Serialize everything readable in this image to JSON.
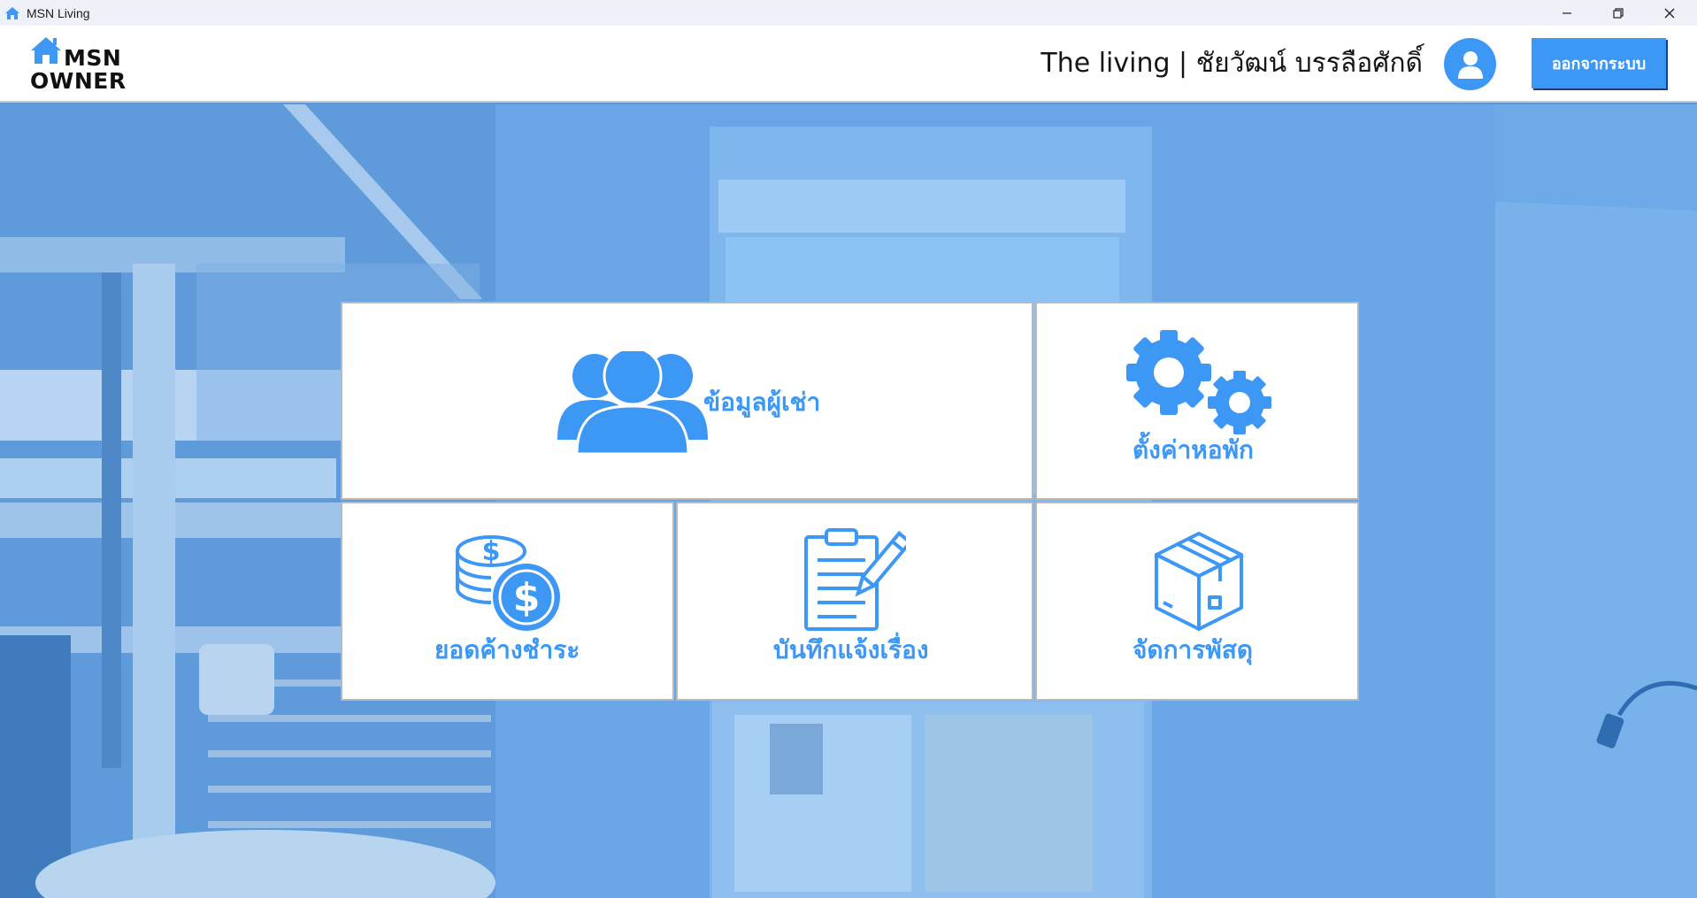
{
  "window": {
    "title": "MSN Living",
    "controls": [
      "minimize",
      "restore",
      "close"
    ]
  },
  "header": {
    "logo_line1": "MSN",
    "logo_line2": "OWNER",
    "user_title": "The living | ชัยวัฒน์ บรรลือศักดิ์",
    "logout_label": "ออกจากระบบ"
  },
  "menu": {
    "tenants": {
      "label": "ข้อมูลผู้เช่า",
      "icon": "users-icon"
    },
    "settings": {
      "label": "ตั้งค่าหอพัก",
      "icon": "gears-icon"
    },
    "outstanding": {
      "label": "ยอดค้างชำระ",
      "icon": "coins-dollar-icon"
    },
    "issues": {
      "label": "บันทึกแจ้งเรื่อง",
      "icon": "clipboard-pencil-icon"
    },
    "parcels": {
      "label": "จัดการพัสดุ",
      "icon": "box-icon"
    }
  },
  "colors": {
    "accent": "#3d97f5",
    "background_tint": "#5d97d8"
  }
}
